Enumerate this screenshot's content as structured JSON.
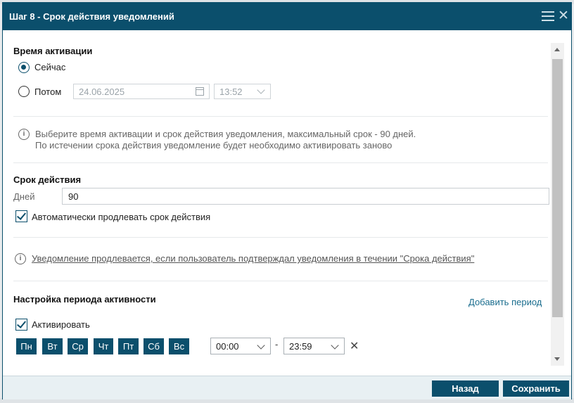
{
  "dialog": {
    "title": "Шаг 8 - Срок действия уведомлений"
  },
  "activation": {
    "title": "Время активации",
    "now_label": "Сейчас",
    "later_label": "Потом",
    "date_value": "24.06.2025",
    "time_value": "13:52",
    "selected": "now"
  },
  "info1": {
    "line1": "Выберите время активации и срок действия уведомления, максимальный срок - 90 дней.",
    "line2": "По истечении срока действия уведомление будет необходимо активировать заново"
  },
  "validity": {
    "title": "Срок действия",
    "days_label": "Дней",
    "days_value": "90",
    "auto_extend_label": "Автоматически продлевать срок действия",
    "auto_extend_checked": true
  },
  "info2": {
    "text": "Уведомление продлевается, если пользователь подтверждал уведомления в течении \"Срока действия\""
  },
  "activity": {
    "title": "Настройка периода активности",
    "add_period": "Добавить период",
    "activate_label": "Активировать",
    "activate_checked": true,
    "days": [
      "Пн",
      "Вт",
      "Ср",
      "Чт",
      "Пт",
      "Сб",
      "Вс"
    ],
    "from_time": "00:00",
    "to_time": "23:59",
    "dash": "-"
  },
  "footer": {
    "back_label": "Назад",
    "save_label": "Сохранить"
  },
  "colors": {
    "accent": "#0b4f6c",
    "link": "#1a6d8e"
  }
}
